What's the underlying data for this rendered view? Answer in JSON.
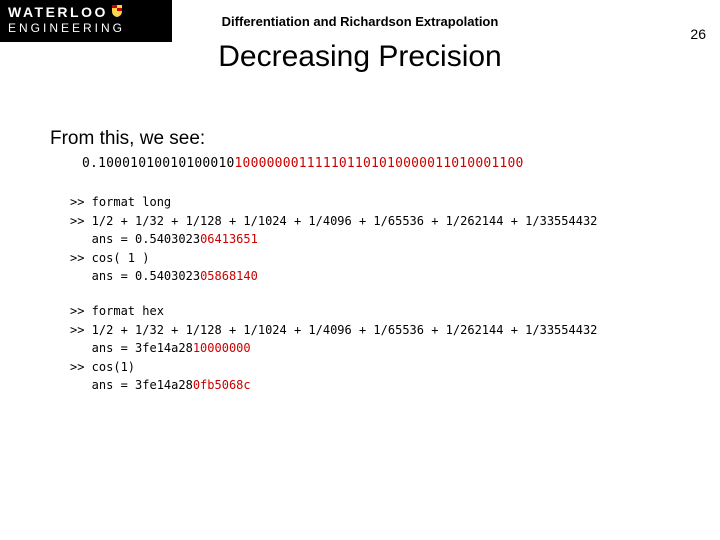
{
  "logo": {
    "word": "WATERLOO",
    "sub": "ENGINEERING"
  },
  "header_caption": "Differentiation and Richardson Extrapolation",
  "title": "Decreasing Precision",
  "page_number": "26",
  "lead_text": "From this, we see:",
  "binary": {
    "prefix": "0.",
    "black": "10001010010100010",
    "red": "100000001111101101010000011010001100"
  },
  "block1": {
    "l1": ">> format long",
    "l2": ">> 1/2 + 1/32 + 1/128 + 1/1024 + 1/4096 + 1/65536 + 1/262144 + 1/33554432",
    "l3_label": "   ans = ",
    "l3_black": "0.5403023",
    "l3_red": "06413651",
    "l4": ">> cos( 1 )",
    "l5_label": "   ans = ",
    "l5_black": "0.5403023",
    "l5_red": "05868140"
  },
  "block2": {
    "l1": ">> format hex",
    "l2": ">> 1/2 + 1/32 + 1/128 + 1/1024 + 1/4096 + 1/65536 + 1/262144 + 1/33554432",
    "l3_label": "   ans = ",
    "l3_black": "3fe14a28",
    "l3_red": "10000000",
    "l4": ">> cos(1)",
    "l5_label": "   ans = ",
    "l5_black": "3fe14a28",
    "l5_red": "0fb5068c"
  }
}
